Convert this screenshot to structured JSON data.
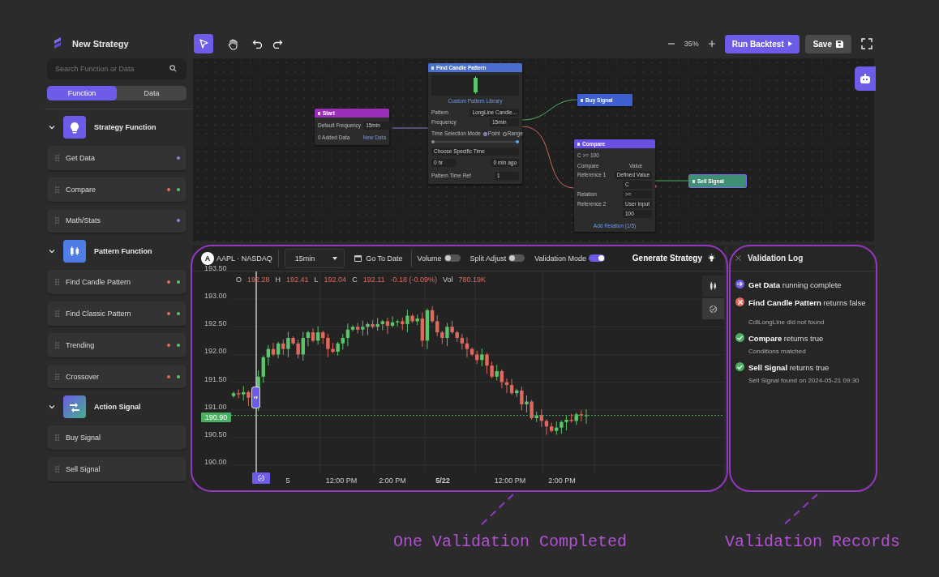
{
  "app": {
    "title": "New Strategy"
  },
  "sidebar": {
    "search": {
      "placeholder": "Search Function or Data"
    },
    "tabs": [
      {
        "label": "Function",
        "selected": true
      },
      {
        "label": "Data",
        "selected": false
      }
    ],
    "sections": [
      {
        "title": "Strategy Function",
        "expanded": true,
        "items": [
          {
            "label": "Get Data",
            "dots": [
              {
                "color": "#8f86d8"
              }
            ]
          },
          {
            "label": "Compare",
            "dots": [
              {
                "color": "#e0685c"
              },
              {
                "color": "#5cc46a"
              }
            ]
          },
          {
            "label": "Math/Stats",
            "dots": [
              {
                "color": "#8f86d8"
              }
            ]
          }
        ]
      },
      {
        "title": "Pattern Function",
        "expanded": true,
        "items": [
          {
            "label": "Find Candle Pattern",
            "dots": [
              {
                "color": "#e0685c"
              },
              {
                "color": "#5cc46a"
              }
            ]
          },
          {
            "label": "Find Classic Pattern",
            "dots": [
              {
                "color": "#e0685c"
              },
              {
                "color": "#5cc46a"
              }
            ]
          },
          {
            "label": "Trending",
            "dots": [
              {
                "color": "#e0685c"
              },
              {
                "color": "#5cc46a"
              }
            ]
          },
          {
            "label": "Crossover",
            "dots": [
              {
                "color": "#e0685c"
              },
              {
                "color": "#5cc46a"
              }
            ]
          }
        ]
      },
      {
        "title": "Action Signal",
        "expanded": true,
        "items": [
          {
            "label": "Buy Signal"
          },
          {
            "label": "Sell Signal"
          }
        ]
      }
    ]
  },
  "toolbar": {
    "tools": [
      {
        "selected": true
      },
      {
        "selected": false
      }
    ],
    "zoom": "35%",
    "run_button": "Run Backtest",
    "save_button": "Save"
  },
  "canvas": {
    "nodes": [
      {
        "kind": "start",
        "title": "Start",
        "color": "#9b2fb8",
        "fields": [
          {
            "label": "Default Frequency",
            "value": "15min"
          }
        ],
        "footer_label": "0 Added Data",
        "footer_link": "New Data"
      },
      {
        "kind": "pattern",
        "title": "Find Candle Pattern",
        "color": "#4a6fd0",
        "library_link": "Custom Pattern Library",
        "fields": [
          {
            "label": "Pattern",
            "value": "LongLine Candle..."
          },
          {
            "label": "Frequency",
            "value": "15min"
          }
        ],
        "mode_label": "Time Selection Mode",
        "modes": [
          {
            "label": "Point",
            "selected": true
          },
          {
            "label": "Range",
            "selected": false
          }
        ],
        "level": 1,
        "time_select": "Choose Specific Time",
        "hours": "0",
        "hours_unit": "hr",
        "minutes": "0",
        "minutes_unit": "min ago",
        "ref_label": "Pattern Time Ref",
        "ref_value": "1"
      },
      {
        "kind": "signal",
        "title": "Buy Signal",
        "color": "#3d5fd0"
      },
      {
        "kind": "compare",
        "title": "Compare",
        "color": "#6a4fe0",
        "condition": "C >= 100",
        "compare_label": "Compare",
        "compare_option": "Value",
        "fields": [
          {
            "label": "Reference 1",
            "value": "Defined Value"
          },
          {
            "value": "C"
          },
          {
            "label": "Relation",
            "value": ">="
          },
          {
            "label": "Reference 2",
            "value": "User Input"
          },
          {
            "value": "100"
          }
        ],
        "add_link": "Add Relation (1/5)"
      },
      {
        "kind": "signal",
        "title": "Sell Signal",
        "color": "#3f8f76"
      }
    ]
  },
  "chart": {
    "badge": "A",
    "symbol": "AAPL · NASDAQ",
    "interval": "15min",
    "go_to_date": "Go To Date",
    "toggles": [
      {
        "label": "Volume",
        "on": false
      },
      {
        "label": "Split Adjust",
        "on": false
      },
      {
        "label": "Validation Mode",
        "on": true
      }
    ],
    "generate": "Generate Strategy",
    "legend": [
      {
        "key": "O",
        "value": "192.28"
      },
      {
        "key": "H",
        "value": "192.41"
      },
      {
        "key": "L",
        "value": "192.04"
      },
      {
        "key": "C",
        "value": "192.11"
      }
    ],
    "change": "-0.18 (-0.09%)",
    "volume_key": "Vol",
    "volume": "780.19K",
    "y_labels": [
      "193.50",
      "193.00",
      "192.50",
      "192.00",
      "191.50",
      "191.00",
      "190.50",
      "190.00"
    ],
    "x_labels": [
      {
        "label": "5",
        "bold": false
      },
      {
        "label": "12:00 PM",
        "bold": false
      },
      {
        "label": "2:00 PM",
        "bold": false
      },
      {
        "label": "5/22",
        "bold": true
      },
      {
        "label": "12:00 PM",
        "bold": false
      },
      {
        "label": "2:00 PM",
        "bold": false
      }
    ],
    "price_tag": "190.90"
  },
  "validation_log": {
    "title": "Validation Log",
    "entries": [
      {
        "kind": "info",
        "text": "**Get Data** running complete"
      },
      {
        "kind": "error",
        "text": "**Find Candle Pattern** returns false",
        "detail": "CdlLongLine did not found"
      },
      {
        "kind": "success",
        "text": "**Compare** returns true",
        "detail": "Conditions matched"
      },
      {
        "kind": "success",
        "text": "**Sell Signal** returns true",
        "detail": "Sell Signal found on  2024-05-21 09:30"
      }
    ]
  },
  "annotations": [
    {
      "caption": "One Validation Completed"
    },
    {
      "caption": "Validation Records"
    }
  ]
}
